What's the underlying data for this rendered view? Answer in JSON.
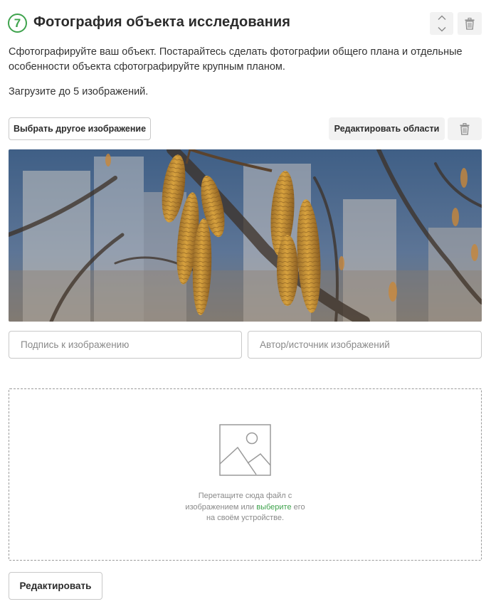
{
  "block": {
    "step_number": "7",
    "title": "Фотография объекта исследования",
    "description": "Сфотографируйте ваш объект. Постарайтесь сделать фотографии общего плана и отдельные особенности объекта сфотографируйте крупным планом.",
    "upload_limit": "Загрузите до 5 изображений."
  },
  "image_toolbar": {
    "choose_other_label": "Выбрать другое изображение",
    "edit_areas_label": "Редактировать области"
  },
  "fields": {
    "caption_placeholder": "Подпись к изображению",
    "author_placeholder": "Автор/источник изображений"
  },
  "dropzone": {
    "line1": "Перетащите сюда файл с",
    "line2_before": "изображением или ",
    "link": "выберите",
    "line2_after": " его",
    "line3": "на своём устройстве."
  },
  "footer": {
    "edit_label": "Редактировать"
  },
  "colors": {
    "accent": "#3fa34d",
    "border": "#c8c8c8",
    "button_gray": "#f2f2f2"
  },
  "icons": [
    "chevron-up-icon",
    "chevron-down-icon",
    "trash-icon",
    "image-placeholder-icon"
  ]
}
